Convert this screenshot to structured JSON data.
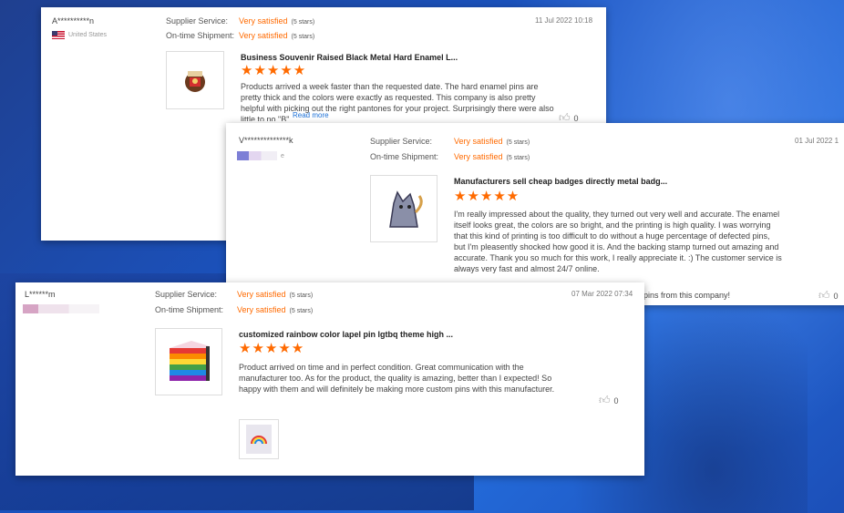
{
  "labels": {
    "supplier_service": "Supplier Service:",
    "ontime_shipment": "On-time Shipment:",
    "rating_value": "Very satisfied",
    "rating_note": "(5 stars)",
    "read_more": "Read more"
  },
  "reviews": [
    {
      "user": "A**********n",
      "country": "United States",
      "date": "11 Jul 2022 10:18",
      "product_title": "Business Souvenir Raised Black Metal Hard Enamel L...",
      "stars": "★★★★★",
      "text": "Products arrived a week faster than the requested date. The hard enamel pins are pretty thick and the colors were exactly as requested. This company is also pretty helpful with picking out the right pantones for your project. Surprisingly there were also little to no \"B\"...",
      "likes": "0"
    },
    {
      "user": "V**************k",
      "country": "e",
      "date": "01 Jul 2022 1",
      "product_title": "Manufacturers sell cheap badges directly metal badg...",
      "stars": "★★★★★",
      "text": "I'm really impressed about the quality, they turned out very well and accurate. The enamel itself looks great, the colors are so bright, and the printing is high quality. I was worrying that this kind of printing is too difficult to do without a huge percentage of defected pins, but I'm pleasently shocked how good it is. And the backing stamp turned out amazing and accurate. Thank you so much for this work, I really appreciate it. :) The customer service is always very fast and almost 24/7 online.",
      "text_tail": "pins from this company!",
      "likes": "0"
    },
    {
      "user": "L******m",
      "date": "07 Mar 2022 07:34",
      "product_title": "customized rainbow color lapel pin lgtbq theme high ...",
      "stars": "★★★★★",
      "text": "Product arrived on time and in perfect condition. Great communication with the manufacturer too. As for the product, the quality is amazing, better than I expected! So happy with them and will definitely be making more custom pins with this manufacturer.",
      "likes": "0"
    }
  ],
  "colors": {
    "accent": "#ff6a00",
    "link": "#1a6fd6",
    "underline": "#d6001c"
  },
  "icons": {
    "like": "thumbs-up-icon",
    "flag": "us-flag-icon"
  }
}
